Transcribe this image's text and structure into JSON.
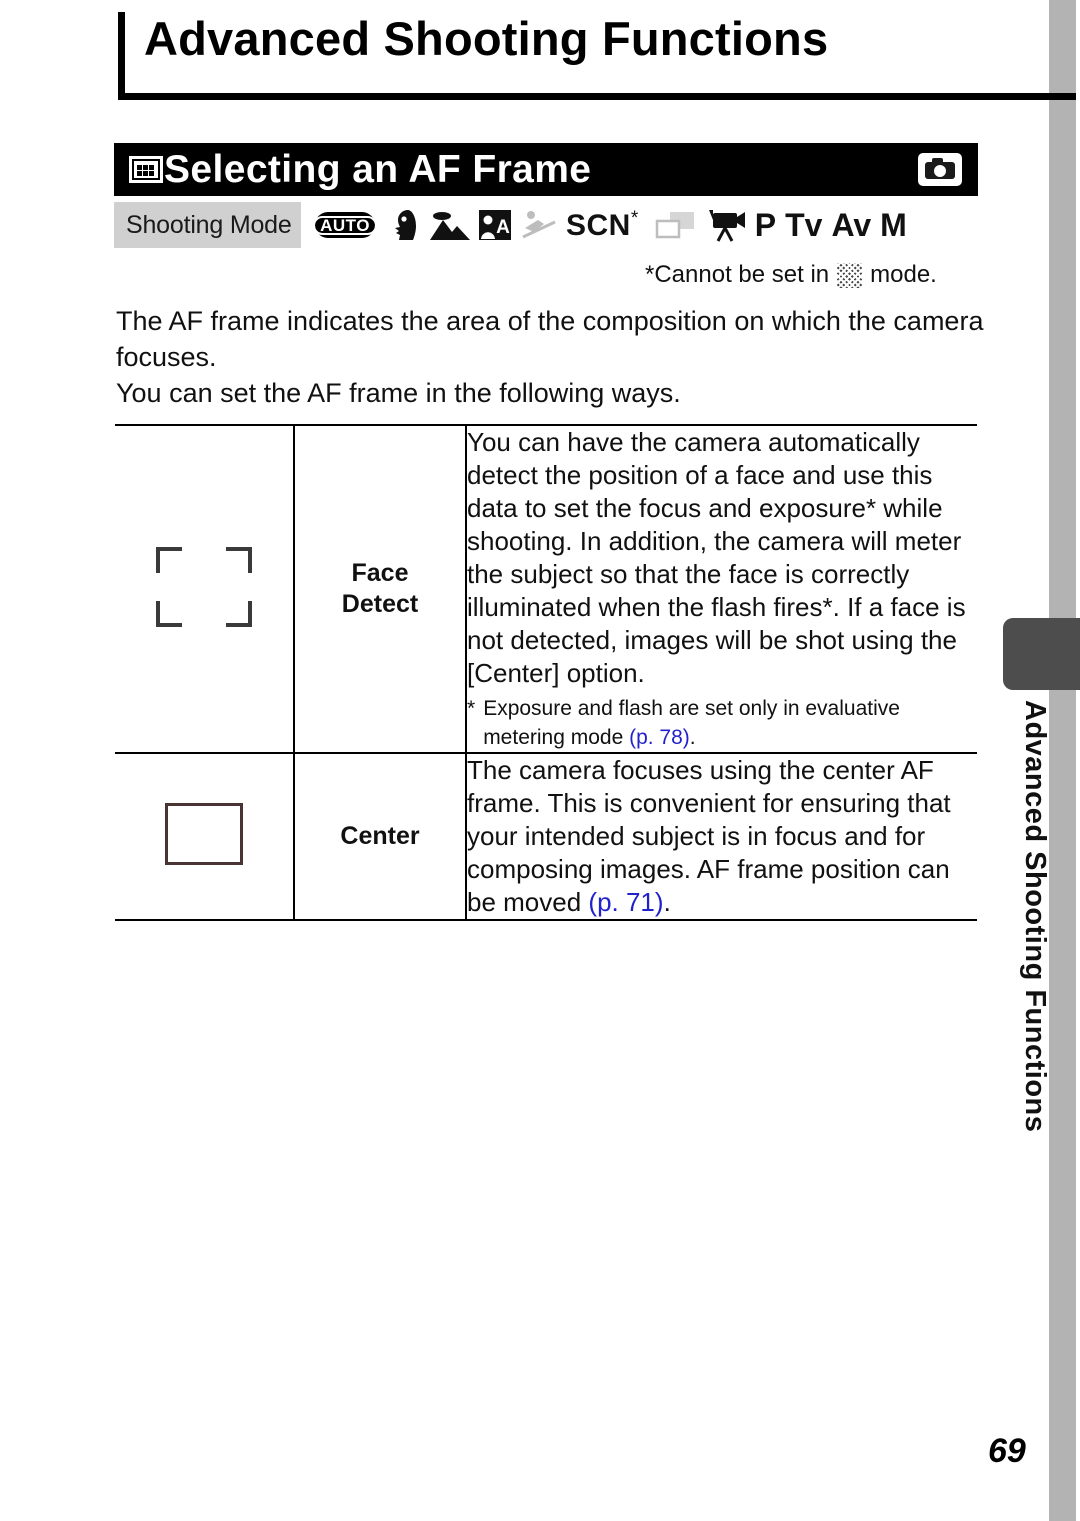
{
  "chapter": {
    "title": "Advanced Shooting Functions"
  },
  "section": {
    "icon": "af-frame-grid-icon",
    "title": "Selecting an AF Frame",
    "badge_icon": "camera-icon"
  },
  "shooting_mode": {
    "label": "Shooting Mode",
    "icons": [
      {
        "name": "auto-mode-icon",
        "label": "AUTO"
      },
      {
        "name": "portrait-mode-icon",
        "label": ""
      },
      {
        "name": "landscape-mode-icon",
        "label": ""
      },
      {
        "name": "night-scene-mode-icon",
        "label": ""
      },
      {
        "name": "sports-mode-icon",
        "label": ""
      },
      {
        "name": "scene-mode-icon",
        "label": "SCN",
        "superscript": "*"
      },
      {
        "name": "stitch-assist-mode-icon",
        "label": ""
      },
      {
        "name": "movie-mode-icon",
        "label": ""
      },
      {
        "name": "program-mode-letter",
        "label": "P"
      },
      {
        "name": "shutter-priority-mode-letter",
        "label": "Tv"
      },
      {
        "name": "aperture-priority-mode-letter",
        "label": "Av"
      },
      {
        "name": "manual-mode-letter",
        "label": "M"
      }
    ]
  },
  "mode_footnote": {
    "before": "*Cannot be set in",
    "icon": "dither-mode-icon",
    "after": "mode."
  },
  "intro": {
    "line1": "The AF frame indicates the area of the composition on which the camera focuses.",
    "line2": "You can set the AF frame in the following ways."
  },
  "table": {
    "rows": [
      {
        "icon": "face-detect-frame-icon",
        "name_line1": "Face",
        "name_line2": "Detect",
        "description": "You can have the camera automatically detect the position of a face and use this data to set the focus and exposure* while shooting. In addition, the camera will meter the subject so that the face is correctly illuminated when the flash fires*. If a face is not detected, images will be shot using the [Center] option.",
        "footnote_marker": "*",
        "footnote_text": "Exposure and flash are set only in evaluative metering mode ",
        "footnote_ref": "(p. 78)",
        "footnote_tail": "."
      },
      {
        "icon": "center-frame-icon",
        "name_line1": "Center",
        "name_line2": "",
        "description": "The camera focuses using the center AF frame. This is convenient for ensuring that your intended subject is in focus and for composing images. AF frame position can be moved ",
        "description_ref": "(p. 71)",
        "description_tail": "."
      }
    ]
  },
  "side_tab": {
    "text": "Advanced Shooting Functions"
  },
  "page_number": "69",
  "colors": {
    "link": "#2222cc",
    "section_bar": "#000000",
    "mode_bar": "#d0d0d0",
    "side_strip": "#b3b3b3",
    "side_tab": "#4d4d4d"
  }
}
